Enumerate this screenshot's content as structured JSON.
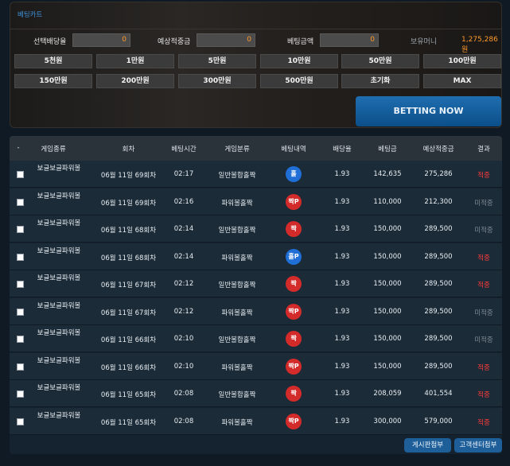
{
  "cart": {
    "title": "베팅카트",
    "select_odds_label": "선택배당율",
    "select_odds_value": "0",
    "expected_label": "예상적중금",
    "expected_value": "0",
    "bet_amount_label": "베팅금액",
    "bet_amount_value": "0",
    "balance_label": "보유머니",
    "balance_value": "1,275,286원",
    "amount_buttons": [
      "5천원",
      "1만원",
      "5만원",
      "10만원",
      "50만원",
      "100만원",
      "150만원",
      "200만원",
      "300만원",
      "500만원",
      "초기화",
      "MAX"
    ],
    "bet_now": "BETTING NOW"
  },
  "table": {
    "headers": [
      "-",
      "게임종류",
      "회차",
      "베팅시간",
      "게임분류",
      "베팅내역",
      "배당율",
      "베팅금",
      "예상적중금",
      "결과"
    ],
    "rows": [
      {
        "game": "보글보글파워볼",
        "round": "06월 11일 69회차",
        "time": "02:17",
        "category": "일반볼합홀짝",
        "pick": "홀",
        "pick_color": "#1f6fd6",
        "odds": "1.93",
        "bet": "142,635",
        "expected": "275,286",
        "result": "적중",
        "win": true
      },
      {
        "game": "보글보글파워볼",
        "round": "06월 11일 69회차",
        "time": "02:16",
        "category": "파워볼홀짝",
        "pick": "짝P",
        "pick_color": "#d32a2a",
        "odds": "1.93",
        "bet": "110,000",
        "expected": "212,300",
        "result": "미적중",
        "win": false
      },
      {
        "game": "보글보글파워볼",
        "round": "06월 11일 68회차",
        "time": "02:14",
        "category": "일반볼합홀짝",
        "pick": "짝",
        "pick_color": "#d32a2a",
        "odds": "1.93",
        "bet": "150,000",
        "expected": "289,500",
        "result": "미적중",
        "win": false
      },
      {
        "game": "보글보글파워볼",
        "round": "06월 11일 68회차",
        "time": "02:14",
        "category": "파워볼홀짝",
        "pick": "홀P",
        "pick_color": "#1f6fd6",
        "odds": "1.93",
        "bet": "150,000",
        "expected": "289,500",
        "result": "적중",
        "win": true
      },
      {
        "game": "보글보글파워볼",
        "round": "06월 11일 67회차",
        "time": "02:12",
        "category": "일반볼합홀짝",
        "pick": "짝",
        "pick_color": "#d32a2a",
        "odds": "1.93",
        "bet": "150,000",
        "expected": "289,500",
        "result": "적중",
        "win": true
      },
      {
        "game": "보글보글파워볼",
        "round": "06월 11일 67회차",
        "time": "02:12",
        "category": "파워볼홀짝",
        "pick": "짝P",
        "pick_color": "#d32a2a",
        "odds": "1.93",
        "bet": "150,000",
        "expected": "289,500",
        "result": "미적중",
        "win": false
      },
      {
        "game": "보글보글파워볼",
        "round": "06월 11일 66회차",
        "time": "02:10",
        "category": "일반볼합홀짝",
        "pick": "짝",
        "pick_color": "#d32a2a",
        "odds": "1.93",
        "bet": "150,000",
        "expected": "289,500",
        "result": "미적중",
        "win": false
      },
      {
        "game": "보글보글파워볼",
        "round": "06월 11일 66회차",
        "time": "02:10",
        "category": "파워볼홀짝",
        "pick": "짝P",
        "pick_color": "#d32a2a",
        "odds": "1.93",
        "bet": "150,000",
        "expected": "289,500",
        "result": "적중",
        "win": true
      },
      {
        "game": "보글보글파워볼",
        "round": "06월 11일 65회차",
        "time": "02:08",
        "category": "일반볼합홀짝",
        "pick": "짝",
        "pick_color": "#d32a2a",
        "odds": "1.93",
        "bet": "208,059",
        "expected": "401,554",
        "result": "적중",
        "win": true
      },
      {
        "game": "보글보글파워볼",
        "round": "06월 11일 65회차",
        "time": "02:08",
        "category": "파워볼홀짝",
        "pick": "짝P",
        "pick_color": "#d32a2a",
        "odds": "1.93",
        "bet": "300,000",
        "expected": "579,000",
        "result": "적중",
        "win": true
      }
    ]
  },
  "footer": {
    "board_attach": "게시판첨부",
    "support_attach": "고객센터첨부"
  }
}
